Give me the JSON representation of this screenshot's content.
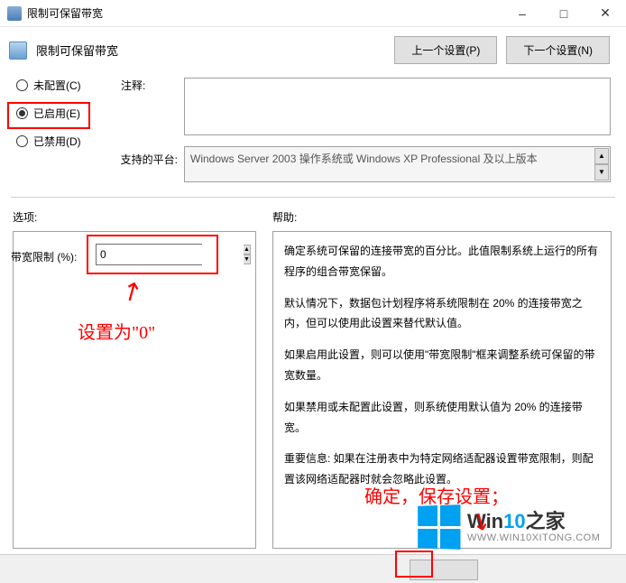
{
  "titlebar": {
    "title": "限制可保留带宽"
  },
  "header": {
    "page_title": "限制可保留带宽",
    "prev_setting": "上一个设置(P)",
    "next_setting": "下一个设置(N)"
  },
  "config_states": {
    "not_configured": "未配置(C)",
    "enabled": "已启用(E)",
    "disabled": "已禁用(D)",
    "selected": "enabled"
  },
  "comment": {
    "label": "注释:",
    "value": ""
  },
  "supported": {
    "label": "支持的平台:",
    "value": "Windows Server 2003 操作系统或 Windows XP Professional 及以上版本"
  },
  "sections": {
    "options_label": "选项:",
    "help_label": "帮助:"
  },
  "options": {
    "bandwidth_limit_label": "带宽限制 (%):",
    "bandwidth_limit_value": "0"
  },
  "help_text": {
    "p1": "确定系统可保留的连接带宽的百分比。此值限制系统上运行的所有程序的组合带宽保留。",
    "p2": "默认情况下，数据包计划程序将系统限制在 20% 的连接带宽之内，但可以使用此设置来替代默认值。",
    "p3": "如果启用此设置，则可以使用\"带宽限制\"框来调整系统可保留的带宽数量。",
    "p4": "如果禁用或未配置此设置，则系统使用默认值为 20% 的连接带宽。",
    "p5": "重要信息: 如果在注册表中为特定网络适配器设置带宽限制，则配置该网络适配器时就会忽略此设置。"
  },
  "annotations": {
    "set_to_zero": "设置为\"0\"",
    "save_settings": "确定，保存设置；"
  },
  "watermark": {
    "brand_prefix": "Win",
    "brand_accent": "10",
    "brand_suffix": "之家",
    "url": "WWW.WIN10XITONG.COM"
  }
}
